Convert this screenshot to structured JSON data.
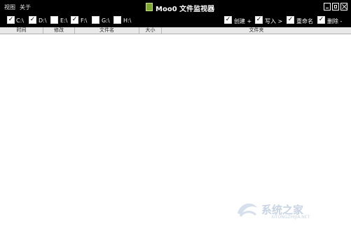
{
  "menu": {
    "view": "视图",
    "about": "关于"
  },
  "app": {
    "title": "Moo0 文件监视器"
  },
  "drives": [
    {
      "label": "C:\\",
      "checked": true
    },
    {
      "label": "D:\\",
      "checked": true
    },
    {
      "label": "E:\\",
      "checked": false
    },
    {
      "label": "F:\\",
      "checked": true
    },
    {
      "label": "G:\\",
      "checked": false
    },
    {
      "label": "H:\\",
      "checked": false
    }
  ],
  "events": [
    {
      "label": "创建 +",
      "checked": true
    },
    {
      "label": "写入 >",
      "checked": true
    },
    {
      "label": "重命名",
      "checked": true
    },
    {
      "label": "删除 -",
      "checked": true
    }
  ],
  "columns": {
    "time": "时间",
    "modified": "修改",
    "filename": "文件名",
    "size": "大小",
    "folder": "文件夹"
  },
  "watermark": {
    "text": "系统之家",
    "url": "XITONGZHIJIA.NET"
  },
  "colors": {
    "titlebar": "#000000",
    "app_icon": "#7fa832",
    "header": "#e8e8e8"
  }
}
